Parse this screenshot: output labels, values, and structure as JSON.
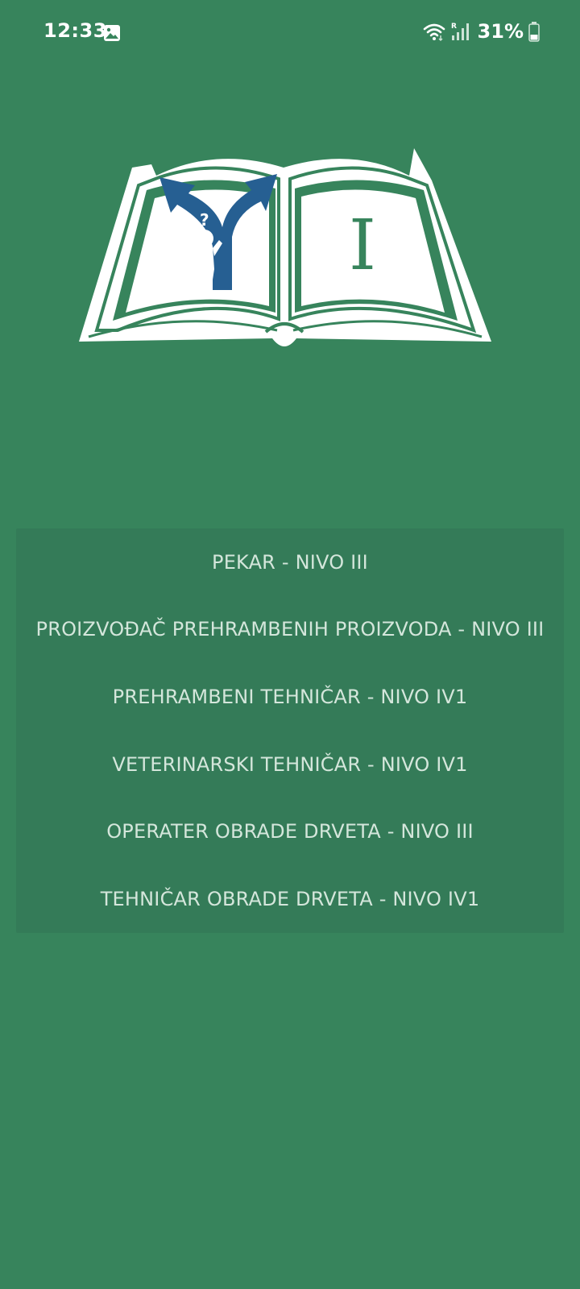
{
  "status_bar": {
    "time": "12:33",
    "battery_percent": "31%",
    "icons": [
      "gallery-icon",
      "wifi-icon",
      "signal-icon",
      "battery-icon"
    ],
    "roaming_label": "R"
  },
  "logo": {
    "icon": "open-book-logo",
    "page_text": "I"
  },
  "menu": {
    "items": [
      {
        "label": "PEKAR - NIVO III"
      },
      {
        "label": "PROIZVOĐAČ PREHRAMBENIH PROIZVODA - NIVO III"
      },
      {
        "label": "PREHRAMBENI TEHNIČAR - NIVO IV1"
      },
      {
        "label": "VETERINARSKI TEHNIČAR - NIVO IV1"
      },
      {
        "label": "OPERATER OBRADE DRVETA - NIVO III"
      },
      {
        "label": "TEHNIČAR OBRADE DRVETA - NIVO IV1"
      }
    ]
  },
  "colors": {
    "background": "#37845c",
    "card": "#347b58",
    "menu_text": "#d4e6db",
    "logo_blue": "#265f92",
    "logo_white": "#ffffff"
  }
}
